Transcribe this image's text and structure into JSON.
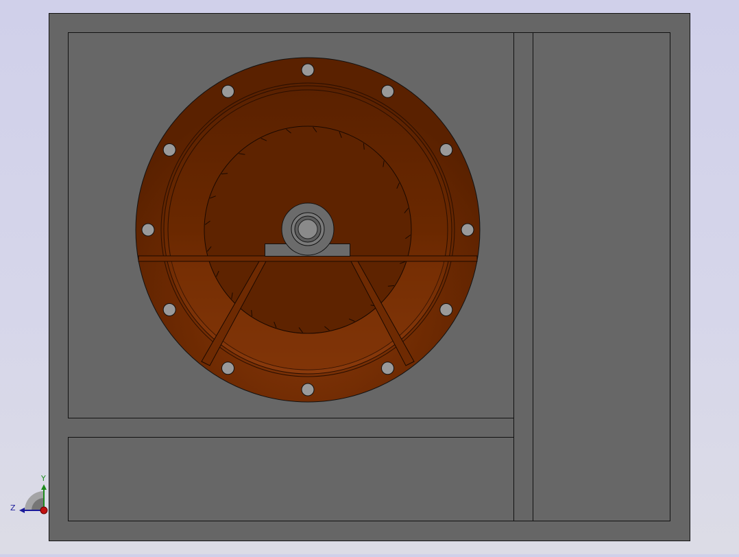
{
  "viewport": {
    "background_top": "#d0d0ea",
    "background_bottom": "#dcdce6"
  },
  "model": {
    "part_color": "#666666",
    "edge_color": "#111111",
    "housing_color": "#6e2a02",
    "housing_dark": "#5a2100",
    "housing_light": "#8a3a0c",
    "bearing_color": "#6b6b6b",
    "bolt_hole_count": 12,
    "inner_tick_count": 24
  },
  "triad": {
    "y_label": "Y",
    "z_label": "Z",
    "y_color": "#1a8a1a",
    "z_color": "#1a1a9a",
    "x_color": "#c01010"
  }
}
